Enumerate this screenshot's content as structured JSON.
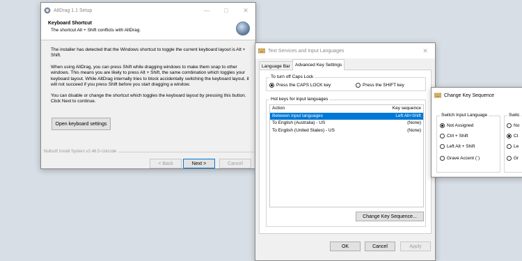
{
  "setup": {
    "title": "AltDrag 1.1 Setup",
    "heading": "Keyboard Shortcut",
    "subheading": "The shortcut Alt + Shift conflicts with AltDrag.",
    "para1": "The installer has detected that the Windows shortcut to toggle the current keyboard layout is Alt + Shift.",
    "para2": "When using AltDrag, you can press Shift while dragging windows to make them snap to other windows. This means you are likely to press Alt + Shift, the same combination which toggles your keyboard layout. While AltDrag internally tries to block accidentally switching the keyboard layout, it will not succeed if you press Shift before you start dragging a window.",
    "para3": "You can disable or change the shortcut which toggles the keyboard layout by pressing this button. Click Next to continue.",
    "open_kb_button": "Open keyboard settings",
    "footer": "Nullsoft Install System v2.46.5-Unicode",
    "back_button": "< Back",
    "next_button": "Next >",
    "cancel_button": "Cancel"
  },
  "tsil": {
    "title": "Text Services and Input Languages",
    "tabs": [
      "Language Bar",
      "Advanced Key Settings"
    ],
    "caps_group": "To turn off Caps Lock",
    "caps_opt1": "Press the CAPS LOCK key",
    "caps_opt2": "Press the SHIFT key",
    "hotkeys_group": "Hot keys for input languages",
    "col_action": "Action",
    "col_keyseq": "Key sequence",
    "rows": [
      {
        "action": "Between input languages",
        "key": "Left Alt+Shift"
      },
      {
        "action": "To English (Australia) - US",
        "key": "(None)"
      },
      {
        "action": "To English (United States) - US",
        "key": "(None)"
      }
    ],
    "change_button": "Change Key Sequence...",
    "ok_button": "OK",
    "cancel_button": "Cancel",
    "apply_button": "Apply"
  },
  "cks": {
    "title": "Change Key Sequence",
    "switch_input_group": "Switch Input Language",
    "switch_kb_group": "Switc",
    "opts": [
      "Not Assigned",
      "Ctrl + Shift",
      "Left Alt + Shift",
      "Grave Accent (`)"
    ],
    "kb_opts": [
      "No",
      "Ct",
      "Le",
      "Gr"
    ]
  },
  "colors": {
    "selection": "#0078d7",
    "desktop": "#d8dee6"
  }
}
